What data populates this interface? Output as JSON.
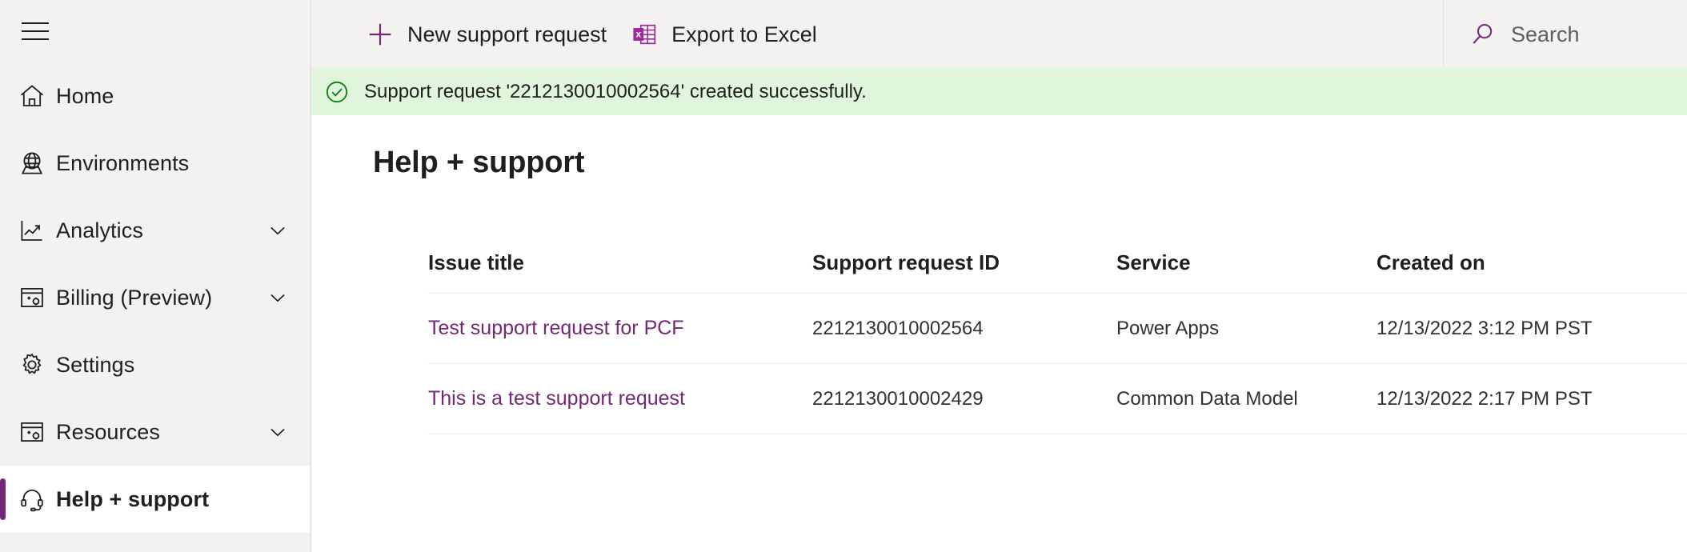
{
  "sidebar": {
    "menu_button": "hamburger-menu",
    "items": [
      {
        "label": "Home",
        "icon": "home-icon",
        "has_chevron": false,
        "selected": false
      },
      {
        "label": "Environments",
        "icon": "globe-icon",
        "has_chevron": false,
        "selected": false
      },
      {
        "label": "Analytics",
        "icon": "chart-line-icon",
        "has_chevron": true,
        "selected": false
      },
      {
        "label": "Billing (Preview)",
        "icon": "billing-icon",
        "has_chevron": true,
        "selected": false
      },
      {
        "label": "Settings",
        "icon": "gear-icon",
        "has_chevron": false,
        "selected": false
      },
      {
        "label": "Resources",
        "icon": "resources-icon",
        "has_chevron": true,
        "selected": false
      },
      {
        "label": "Help + support",
        "icon": "headset-icon",
        "has_chevron": false,
        "selected": true
      }
    ]
  },
  "commandbar": {
    "new_request_label": "New support request",
    "export_excel_label": "Export to Excel"
  },
  "search": {
    "placeholder": "Search",
    "value": ""
  },
  "messagebar": {
    "text": "Support request '2212130010002564' created successfully.",
    "icon": "check-circle-icon"
  },
  "page": {
    "title": "Help + support"
  },
  "table": {
    "columns": [
      "Issue title",
      "Support request ID",
      "Service",
      "Created on"
    ],
    "rows": [
      {
        "issue_title": "Test support request for PCF",
        "support_request_id": "2212130010002564",
        "service": "Power Apps",
        "created_on": "12/13/2022 3:12 PM PST"
      },
      {
        "issue_title": "This is a test support request",
        "support_request_id": "2212130010002429",
        "service": "Common Data Model",
        "created_on": "12/13/2022 2:17 PM PST"
      }
    ]
  },
  "colors": {
    "accent_purple": "#742774",
    "link_purple": "#742774",
    "success_bg": "#dff6dd",
    "success_icon": "#107c10",
    "sidebar_bg": "#f3f2f1",
    "commandbar_bg": "#f3f2f1",
    "excel_icon": "#9b2b9b"
  }
}
